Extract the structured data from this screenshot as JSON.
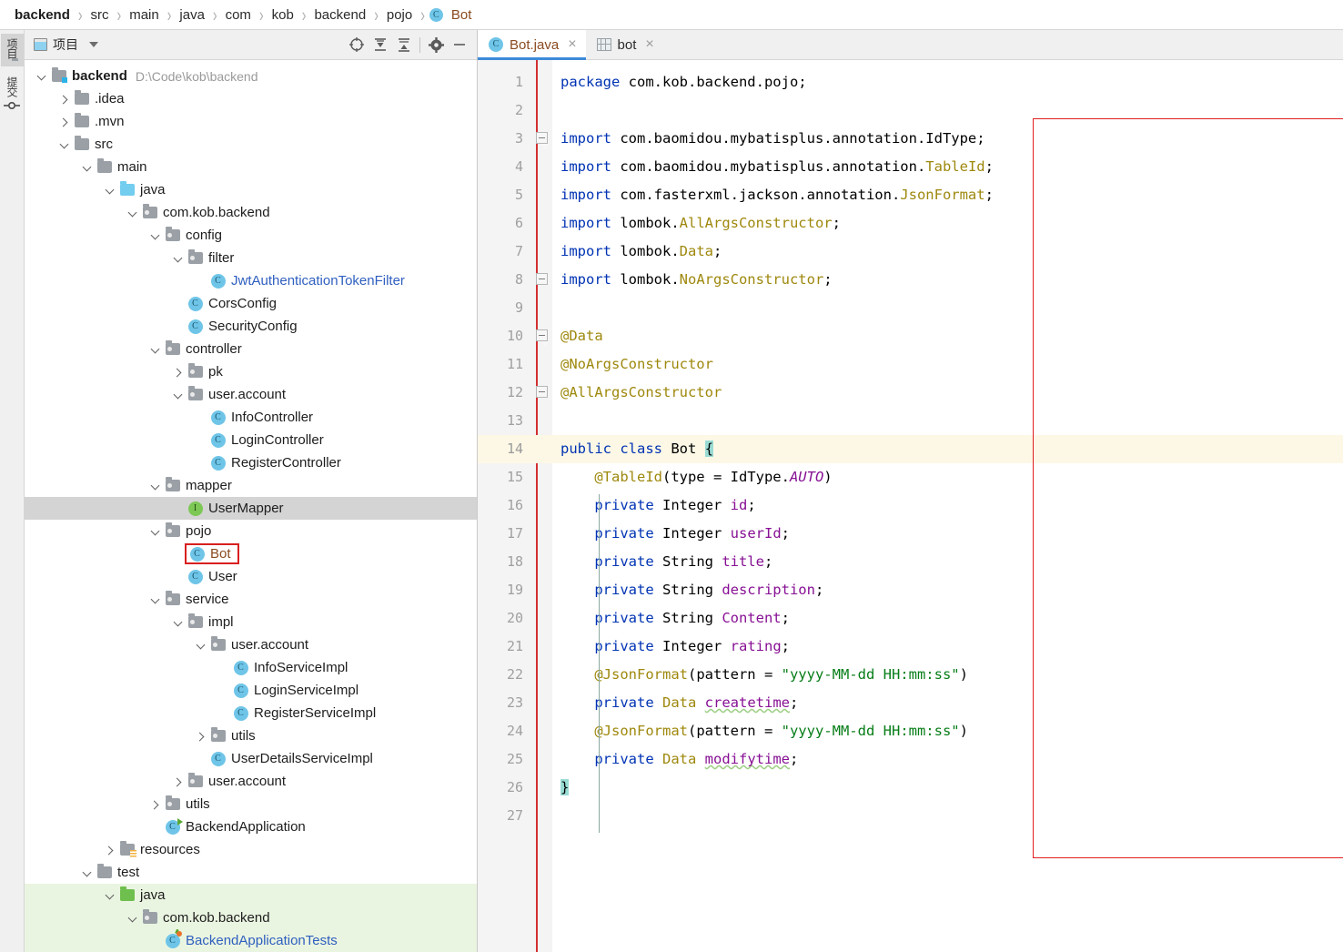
{
  "breadcrumb": {
    "items": [
      {
        "label": "backend",
        "icon": null
      },
      {
        "label": "src",
        "icon": null
      },
      {
        "label": "main",
        "icon": null
      },
      {
        "label": "java",
        "icon": null
      },
      {
        "label": "com",
        "icon": null
      },
      {
        "label": "kob",
        "icon": null
      },
      {
        "label": "backend",
        "icon": null
      },
      {
        "label": "pojo",
        "icon": null
      },
      {
        "label": "Bot",
        "icon": "class-icon"
      }
    ],
    "separator": "›"
  },
  "tool_strip": {
    "items": [
      {
        "name": "project-tool",
        "label": "项目",
        "icon": "grid-icon",
        "active": true
      },
      {
        "name": "commit-tool",
        "label": "提交",
        "icon": "node-icon",
        "active": false
      }
    ]
  },
  "project_panel": {
    "title": "项目",
    "title_icon": "window-icon",
    "dropdown_icon": "chevron-down-icon",
    "toolbar": [
      {
        "name": "select-opened-file-button",
        "icon": "crosshair-icon"
      },
      {
        "name": "expand-all-button",
        "icon": "expand-all-icon"
      },
      {
        "name": "collapse-all-button",
        "icon": "collapse-all-icon"
      },
      {
        "name": "settings-button",
        "icon": "gear-icon"
      },
      {
        "name": "hide-button",
        "icon": "minus-icon"
      }
    ],
    "tree": [
      {
        "label": "backend",
        "hint": "D:\\Code\\kob\\backend",
        "depth": 0,
        "arrow": "down",
        "icon": "folder-module",
        "style": "bold"
      },
      {
        "label": ".idea",
        "depth": 1,
        "arrow": "right",
        "icon": "folder-gray"
      },
      {
        "label": ".mvn",
        "depth": 1,
        "arrow": "right",
        "icon": "folder-gray"
      },
      {
        "label": "src",
        "depth": 1,
        "arrow": "down",
        "icon": "folder-gray"
      },
      {
        "label": "main",
        "depth": 2,
        "arrow": "down",
        "icon": "folder-gray"
      },
      {
        "label": "java",
        "depth": 3,
        "arrow": "down",
        "icon": "folder-blue"
      },
      {
        "label": "com.kob.backend",
        "depth": 4,
        "arrow": "down",
        "icon": "folder-package"
      },
      {
        "label": "config",
        "depth": 5,
        "arrow": "down",
        "icon": "folder-package"
      },
      {
        "label": "filter",
        "depth": 6,
        "arrow": "down",
        "icon": "folder-package"
      },
      {
        "label": "JwtAuthenticationTokenFilter",
        "depth": 7,
        "arrow": "none",
        "icon": "class-icon",
        "style": "blue"
      },
      {
        "label": "CorsConfig",
        "depth": 6,
        "arrow": "none",
        "icon": "class-icon"
      },
      {
        "label": "SecurityConfig",
        "depth": 6,
        "arrow": "none",
        "icon": "class-icon"
      },
      {
        "label": "controller",
        "depth": 5,
        "arrow": "down",
        "icon": "folder-package"
      },
      {
        "label": "pk",
        "depth": 6,
        "arrow": "right",
        "icon": "folder-package"
      },
      {
        "label": "user.account",
        "depth": 6,
        "arrow": "down",
        "icon": "folder-package"
      },
      {
        "label": "InfoController",
        "depth": 7,
        "arrow": "none",
        "icon": "class-icon"
      },
      {
        "label": "LoginController",
        "depth": 7,
        "arrow": "none",
        "icon": "class-icon"
      },
      {
        "label": "RegisterController",
        "depth": 7,
        "arrow": "none",
        "icon": "class-icon"
      },
      {
        "label": "mapper",
        "depth": 5,
        "arrow": "down",
        "icon": "folder-package"
      },
      {
        "label": "UserMapper",
        "depth": 6,
        "arrow": "none",
        "icon": "interface-icon",
        "row_bg": "gray"
      },
      {
        "label": "pojo",
        "depth": 5,
        "arrow": "down",
        "icon": "folder-package"
      },
      {
        "label": "Bot",
        "depth": 6,
        "arrow": "none",
        "icon": "class-icon",
        "outlined": true
      },
      {
        "label": "User",
        "depth": 6,
        "arrow": "none",
        "icon": "class-icon"
      },
      {
        "label": "service",
        "depth": 5,
        "arrow": "down",
        "icon": "folder-package"
      },
      {
        "label": "impl",
        "depth": 6,
        "arrow": "down",
        "icon": "folder-package"
      },
      {
        "label": "user.account",
        "depth": 7,
        "arrow": "down",
        "icon": "folder-package"
      },
      {
        "label": "InfoServiceImpl",
        "depth": 8,
        "arrow": "none",
        "icon": "class-icon"
      },
      {
        "label": "LoginServiceImpl",
        "depth": 8,
        "arrow": "none",
        "icon": "class-icon"
      },
      {
        "label": "RegisterServiceImpl",
        "depth": 8,
        "arrow": "none",
        "icon": "class-icon"
      },
      {
        "label": "utils",
        "depth": 7,
        "arrow": "right",
        "icon": "folder-package"
      },
      {
        "label": "UserDetailsServiceImpl",
        "depth": 7,
        "arrow": "none",
        "icon": "class-icon"
      },
      {
        "label": "user.account",
        "depth": 6,
        "arrow": "right",
        "icon": "folder-package"
      },
      {
        "label": "utils",
        "depth": 5,
        "arrow": "right",
        "icon": "folder-package"
      },
      {
        "label": "BackendApplication",
        "depth": 5,
        "arrow": "none",
        "icon": "class-run-icon"
      },
      {
        "label": "resources",
        "depth": 3,
        "arrow": "right",
        "icon": "folder-resources"
      },
      {
        "label": "test",
        "depth": 2,
        "arrow": "down",
        "icon": "folder-gray"
      },
      {
        "label": "java",
        "depth": 3,
        "arrow": "down",
        "icon": "folder-green",
        "row_bg": "green"
      },
      {
        "label": "com.kob.backend",
        "depth": 4,
        "arrow": "down",
        "icon": "folder-package",
        "row_bg": "green"
      },
      {
        "label": "BackendApplicationTests",
        "depth": 5,
        "arrow": "none",
        "icon": "class-test-icon",
        "style": "blue",
        "row_bg": "green"
      }
    ]
  },
  "editor": {
    "tabs": [
      {
        "label": "Bot.java",
        "icon": "class-icon",
        "active": true,
        "close_icon": "close-icon"
      },
      {
        "label": "bot",
        "icon": "table-icon",
        "active": false,
        "close_icon": "close-icon"
      }
    ],
    "current_line": 14,
    "line_numbers": [
      1,
      2,
      3,
      4,
      5,
      6,
      7,
      8,
      9,
      10,
      11,
      12,
      13,
      14,
      15,
      16,
      17,
      18,
      19,
      20,
      21,
      22,
      23,
      24,
      25,
      26,
      27
    ],
    "code_lines": [
      [
        {
          "t": "package",
          "c": "k"
        },
        {
          "t": " com.kob.backend.pojo;",
          "c": "pl"
        }
      ],
      [],
      [
        {
          "t": "import",
          "c": "k"
        },
        {
          "t": " com.baomidou.mybatisplus.annotation.IdType;",
          "c": "pl"
        }
      ],
      [
        {
          "t": "import",
          "c": "k"
        },
        {
          "t": " com.baomidou.mybatisplus.annotation.",
          "c": "pl"
        },
        {
          "t": "TableId",
          "c": "an"
        },
        {
          "t": ";",
          "c": "pl"
        }
      ],
      [
        {
          "t": "import",
          "c": "k"
        },
        {
          "t": " com.fasterxml.jackson.annotation.",
          "c": "pl"
        },
        {
          "t": "JsonFormat",
          "c": "an"
        },
        {
          "t": ";",
          "c": "pl"
        }
      ],
      [
        {
          "t": "import",
          "c": "k"
        },
        {
          "t": " lombok.",
          "c": "pl"
        },
        {
          "t": "AllArgsConstructor",
          "c": "an"
        },
        {
          "t": ";",
          "c": "pl"
        }
      ],
      [
        {
          "t": "import",
          "c": "k"
        },
        {
          "t": " lombok.",
          "c": "pl"
        },
        {
          "t": "Data",
          "c": "an"
        },
        {
          "t": ";",
          "c": "pl"
        }
      ],
      [
        {
          "t": "import",
          "c": "k"
        },
        {
          "t": " lombok.",
          "c": "pl"
        },
        {
          "t": "NoArgsConstructor",
          "c": "an"
        },
        {
          "t": ";",
          "c": "pl"
        }
      ],
      [],
      [
        {
          "t": "@Data",
          "c": "an"
        }
      ],
      [
        {
          "t": "@NoArgsConstructor",
          "c": "an"
        }
      ],
      [
        {
          "t": "@AllArgsConstructor",
          "c": "an"
        }
      ],
      [],
      [
        {
          "t": "public",
          "c": "k"
        },
        {
          "t": " ",
          "c": "pl"
        },
        {
          "t": "class",
          "c": "k"
        },
        {
          "t": " Bot ",
          "c": "pl"
        },
        {
          "t": "{",
          "c": "caretsel"
        }
      ],
      [
        {
          "t": "    ",
          "c": "pl"
        },
        {
          "t": "@TableId",
          "c": "an"
        },
        {
          "t": "(type = IdType.",
          "c": "pl"
        },
        {
          "t": "AUTO",
          "c": "it"
        },
        {
          "t": ")",
          "c": "pl"
        }
      ],
      [
        {
          "t": "    ",
          "c": "pl"
        },
        {
          "t": "private",
          "c": "k"
        },
        {
          "t": " Integer ",
          "c": "pl"
        },
        {
          "t": "id",
          "c": "fi"
        },
        {
          "t": ";",
          "c": "pl"
        }
      ],
      [
        {
          "t": "    ",
          "c": "pl"
        },
        {
          "t": "private",
          "c": "k"
        },
        {
          "t": " Integer ",
          "c": "pl"
        },
        {
          "t": "userId",
          "c": "fi"
        },
        {
          "t": ";",
          "c": "pl"
        }
      ],
      [
        {
          "t": "    ",
          "c": "pl"
        },
        {
          "t": "private",
          "c": "k"
        },
        {
          "t": " String ",
          "c": "pl"
        },
        {
          "t": "title",
          "c": "fi"
        },
        {
          "t": ";",
          "c": "pl"
        }
      ],
      [
        {
          "t": "    ",
          "c": "pl"
        },
        {
          "t": "private",
          "c": "k"
        },
        {
          "t": " String ",
          "c": "pl"
        },
        {
          "t": "description",
          "c": "fi"
        },
        {
          "t": ";",
          "c": "pl"
        }
      ],
      [
        {
          "t": "    ",
          "c": "pl"
        },
        {
          "t": "private",
          "c": "k"
        },
        {
          "t": " String ",
          "c": "pl"
        },
        {
          "t": "Content",
          "c": "fi"
        },
        {
          "t": ";",
          "c": "pl"
        }
      ],
      [
        {
          "t": "    ",
          "c": "pl"
        },
        {
          "t": "private",
          "c": "k"
        },
        {
          "t": " Integer ",
          "c": "pl"
        },
        {
          "t": "rating",
          "c": "fi"
        },
        {
          "t": ";",
          "c": "pl"
        }
      ],
      [
        {
          "t": "    ",
          "c": "pl"
        },
        {
          "t": "@JsonFormat",
          "c": "an"
        },
        {
          "t": "(pattern = ",
          "c": "pl"
        },
        {
          "t": "\"yyyy-MM-dd HH:mm:ss\"",
          "c": "st"
        },
        {
          "t": ")",
          "c": "pl"
        }
      ],
      [
        {
          "t": "    ",
          "c": "pl"
        },
        {
          "t": "private",
          "c": "k"
        },
        {
          "t": " ",
          "c": "pl"
        },
        {
          "t": "Data",
          "c": "an"
        },
        {
          "t": " ",
          "c": "pl"
        },
        {
          "t": "createtime",
          "c": "fi squig"
        },
        {
          "t": ";",
          "c": "pl"
        }
      ],
      [
        {
          "t": "    ",
          "c": "pl"
        },
        {
          "t": "@JsonFormat",
          "c": "an"
        },
        {
          "t": "(pattern = ",
          "c": "pl"
        },
        {
          "t": "\"yyyy-MM-dd HH:mm:ss\"",
          "c": "st"
        },
        {
          "t": ")",
          "c": "pl"
        }
      ],
      [
        {
          "t": "    ",
          "c": "pl"
        },
        {
          "t": "private",
          "c": "k"
        },
        {
          "t": " ",
          "c": "pl"
        },
        {
          "t": "Data",
          "c": "an"
        },
        {
          "t": " ",
          "c": "pl"
        },
        {
          "t": "modifytime",
          "c": "fi squig"
        },
        {
          "t": ";",
          "c": "pl"
        }
      ],
      [
        {
          "t": "}",
          "c": "caretsel"
        }
      ],
      []
    ],
    "fold_lines": [
      3,
      8,
      10,
      12
    ]
  },
  "colors": {
    "accent_blue": "#3c8ad9",
    "annotation_red": "#e02020",
    "selection_cyan": "#9adcd4",
    "current_line_bg": "#fdf8e6",
    "tree_selection_gray": "#d4d4d4",
    "test_scope_green": "#eaf5e1",
    "keyword_blue": "#0033b3",
    "annotation_gold": "#9e880d",
    "field_purple": "#871094",
    "string_green": "#067d17"
  }
}
